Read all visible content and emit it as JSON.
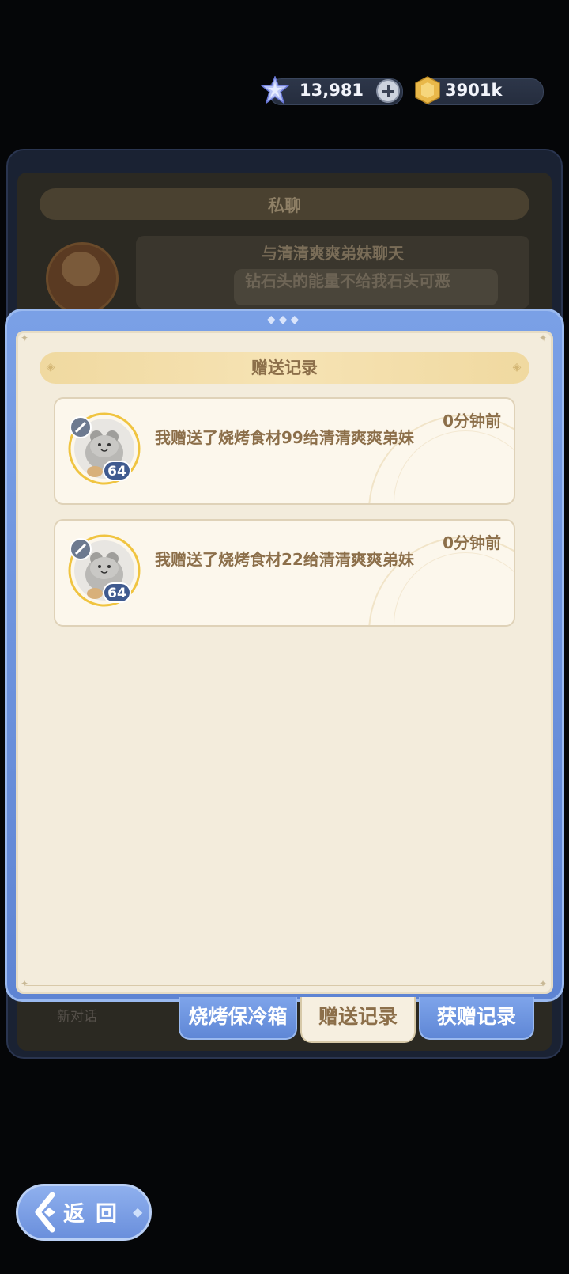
{
  "currency": {
    "gems": "13,981",
    "gold": "3901k"
  },
  "background_panel": {
    "title": "私聊",
    "chat_title": "与清清爽爽弟妹聊天",
    "chat_preview": "钻石头的能量不给我石头可恶",
    "new_chat_label": "新对话"
  },
  "popup": {
    "title": "赠送记录",
    "records": [
      {
        "text": "我赠送了烧烤食材99给清清爽爽弟妹",
        "time": "0分钟前",
        "level": "64"
      },
      {
        "text": "我赠送了烧烤食材22给清清爽爽弟妹",
        "time": "0分钟前",
        "level": "64"
      }
    ]
  },
  "tabs": {
    "cooler": "烧烤保冷箱",
    "sent": "赠送记录",
    "received": "获赠记录"
  },
  "back_button": "返回",
  "colors": {
    "accent_blue": "#6a8fdc",
    "text_brown": "#8c6f4a",
    "panel_cream": "#f3ecdc"
  }
}
